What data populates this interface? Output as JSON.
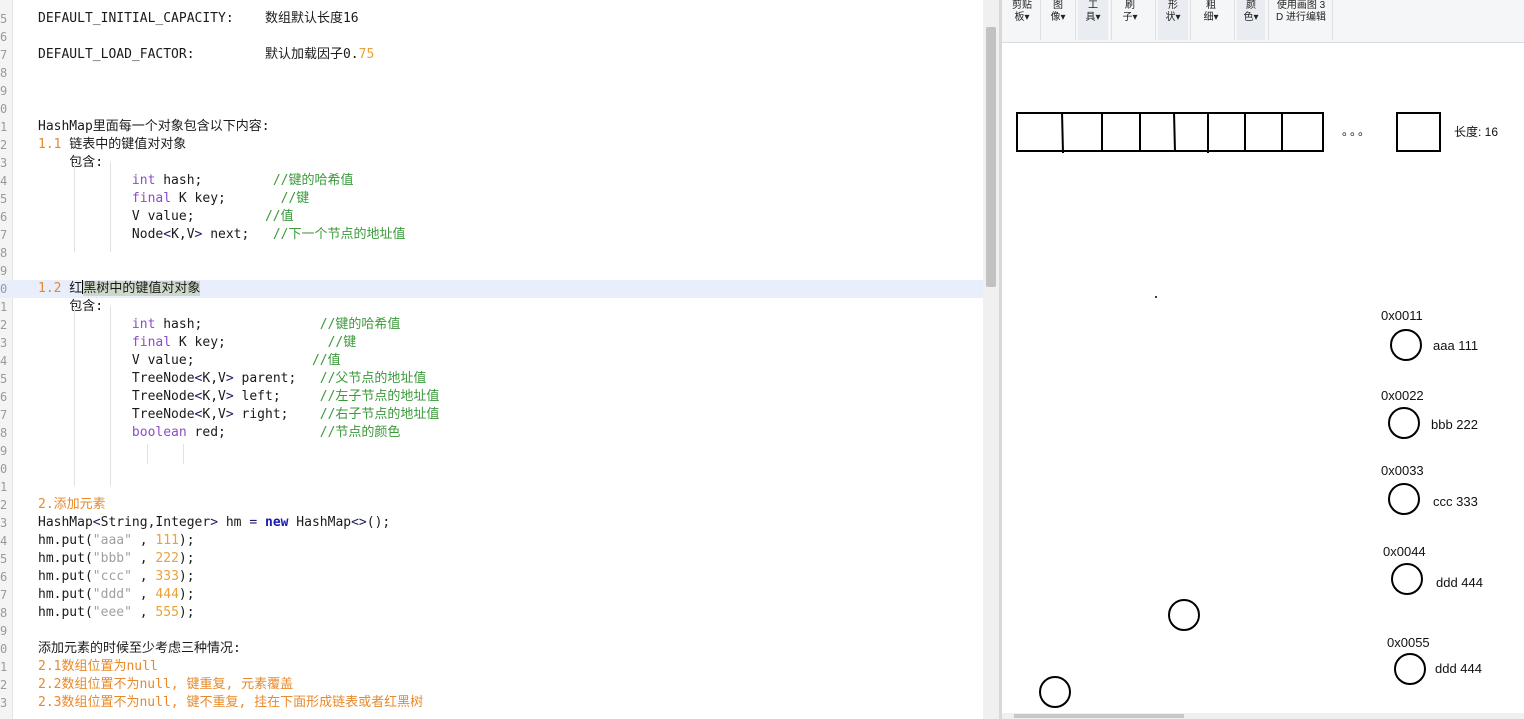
{
  "editor": {
    "lines": [
      {
        "n": "5",
        "segs": [
          [
            "DEFAULT_INITIAL_CAPACITY:    数组默认长度16",
            ""
          ]
        ]
      },
      {
        "n": "6",
        "segs": []
      },
      {
        "n": "7",
        "segs": [
          [
            "DEFAULT_LOAD_FACTOR:         默认加载因子0.",
            ""
          ],
          [
            "75",
            "num"
          ]
        ]
      },
      {
        "n": "8",
        "segs": []
      },
      {
        "n": "9",
        "segs": []
      },
      {
        "n": "0",
        "segs": []
      },
      {
        "n": "1",
        "segs": [
          [
            "HashMap里面每一个对象包含以下内容:",
            ""
          ]
        ]
      },
      {
        "n": "2",
        "segs": [
          [
            "1.1",
            "or"
          ],
          [
            " 链表中的键值对对象",
            ""
          ]
        ]
      },
      {
        "n": "3",
        "segs": [
          [
            "    包含:",
            ""
          ]
        ]
      },
      {
        "n": "4",
        "segs": [
          [
            "            ",
            ""
          ],
          [
            "int",
            "kw"
          ],
          [
            " hash;         ",
            ""
          ],
          [
            "//键的哈希值",
            "cm"
          ]
        ]
      },
      {
        "n": "5",
        "segs": [
          [
            "            ",
            ""
          ],
          [
            "final",
            "kw"
          ],
          [
            " K key;       ",
            ""
          ],
          [
            "//键",
            "cm"
          ]
        ]
      },
      {
        "n": "6",
        "segs": [
          [
            "            V value;         ",
            ""
          ],
          [
            "//值",
            "cm"
          ]
        ]
      },
      {
        "n": "7",
        "segs": [
          [
            "            Node",
            ""
          ],
          [
            "<",
            "op"
          ],
          [
            "K,V",
            ""
          ],
          [
            ">",
            "op"
          ],
          [
            " next;   ",
            ""
          ],
          [
            "//下一个节点的地址值",
            "cm"
          ]
        ]
      },
      {
        "n": "8",
        "segs": []
      },
      {
        "n": "9",
        "segs": []
      },
      {
        "n": "0",
        "segs": [
          [
            "1.2",
            "or"
          ],
          [
            " 红",
            ""
          ],
          [
            "黑树中的键值对对象",
            "sel"
          ]
        ],
        "highlight": true
      },
      {
        "n": "1",
        "segs": [
          [
            "    包含:",
            ""
          ]
        ]
      },
      {
        "n": "2",
        "segs": [
          [
            "            ",
            ""
          ],
          [
            "int",
            "kw"
          ],
          [
            " hash;               ",
            ""
          ],
          [
            "//键的哈希值",
            "cm"
          ]
        ]
      },
      {
        "n": "3",
        "segs": [
          [
            "            ",
            ""
          ],
          [
            "final",
            "kw"
          ],
          [
            " K key;             ",
            ""
          ],
          [
            "//键",
            "cm"
          ]
        ]
      },
      {
        "n": "4",
        "segs": [
          [
            "            V value;               ",
            ""
          ],
          [
            "//值",
            "cm"
          ]
        ]
      },
      {
        "n": "5",
        "segs": [
          [
            "            TreeNode",
            ""
          ],
          [
            "<",
            "op"
          ],
          [
            "K,V",
            ""
          ],
          [
            ">",
            "op"
          ],
          [
            " parent;   ",
            ""
          ],
          [
            "//父节点的地址值",
            "cm"
          ]
        ]
      },
      {
        "n": "6",
        "segs": [
          [
            "            TreeNode",
            ""
          ],
          [
            "<",
            "op"
          ],
          [
            "K,V",
            ""
          ],
          [
            ">",
            "op"
          ],
          [
            " left;     ",
            ""
          ],
          [
            "//左子节点的地址值",
            "cm"
          ]
        ]
      },
      {
        "n": "7",
        "segs": [
          [
            "            TreeNode",
            ""
          ],
          [
            "<",
            "op"
          ],
          [
            "K,V",
            ""
          ],
          [
            ">",
            "op"
          ],
          [
            " right;    ",
            ""
          ],
          [
            "//右子节点的地址值",
            "cm"
          ]
        ]
      },
      {
        "n": "8",
        "segs": [
          [
            "            ",
            ""
          ],
          [
            "boolean",
            "kw"
          ],
          [
            " red;            ",
            ""
          ],
          [
            "//节点的颜色",
            "cm"
          ]
        ]
      },
      {
        "n": "9",
        "segs": []
      },
      {
        "n": "0",
        "segs": []
      },
      {
        "n": "1",
        "segs": []
      },
      {
        "n": "2",
        "segs": [
          [
            "2.添加元素",
            "or"
          ]
        ]
      },
      {
        "n": "3",
        "segs": [
          [
            "HashMap",
            ""
          ],
          [
            "<",
            "op"
          ],
          [
            "String,Integer",
            ""
          ],
          [
            ">",
            "op"
          ],
          [
            " hm ",
            ""
          ],
          [
            "=",
            "op"
          ],
          [
            " ",
            ""
          ],
          [
            "new",
            "new"
          ],
          [
            " HashMap",
            ""
          ],
          [
            "<>",
            "op"
          ],
          [
            "();",
            ""
          ]
        ]
      },
      {
        "n": "4",
        "segs": [
          [
            "hm.put(",
            ""
          ],
          [
            "\"aaa\"",
            "str"
          ],
          [
            " , ",
            ""
          ],
          [
            "111",
            "num"
          ],
          [
            ");",
            ""
          ]
        ]
      },
      {
        "n": "5",
        "segs": [
          [
            "hm.put(",
            ""
          ],
          [
            "\"bbb\"",
            "str"
          ],
          [
            " , ",
            ""
          ],
          [
            "222",
            "num"
          ],
          [
            ");",
            ""
          ]
        ]
      },
      {
        "n": "6",
        "segs": [
          [
            "hm.put(",
            ""
          ],
          [
            "\"ccc\"",
            "str"
          ],
          [
            " , ",
            ""
          ],
          [
            "333",
            "num"
          ],
          [
            ");",
            ""
          ]
        ]
      },
      {
        "n": "7",
        "segs": [
          [
            "hm.put(",
            ""
          ],
          [
            "\"ddd\"",
            "str"
          ],
          [
            " , ",
            ""
          ],
          [
            "444",
            "num"
          ],
          [
            ");",
            ""
          ]
        ]
      },
      {
        "n": "8",
        "segs": [
          [
            "hm.put(",
            ""
          ],
          [
            "\"eee\"",
            "str"
          ],
          [
            " , ",
            ""
          ],
          [
            "555",
            "num"
          ],
          [
            ");",
            ""
          ]
        ]
      },
      {
        "n": "9",
        "segs": []
      },
      {
        "n": "0",
        "segs": [
          [
            "添加元素的时候至少考虑三种情况:",
            ""
          ]
        ]
      },
      {
        "n": "1",
        "segs": [
          [
            "2.1数组位置为null",
            "or"
          ]
        ]
      },
      {
        "n": "2",
        "segs": [
          [
            "2.2数组位置不为null, 键重复, 元素覆盖",
            "or"
          ]
        ]
      },
      {
        "n": "3",
        "segs": [
          [
            "2.3数组位置不为null, 键不重复, 挂在下面形成链表或者红黑树",
            "or"
          ]
        ]
      }
    ]
  },
  "paint": {
    "ribbon": [
      {
        "top": "剪贴",
        "bottom": "板"
      },
      {
        "top": "图",
        "bottom": "像"
      },
      {
        "top": "工",
        "bottom": "具"
      },
      {
        "top": "刷",
        "bottom": "子"
      },
      {
        "top": "形",
        "bottom": "状"
      },
      {
        "top": "粗",
        "bottom": "细"
      },
      {
        "top": "颜",
        "bottom": "色"
      },
      {
        "top": "使用画图 3",
        "bottom": "D 进行编辑"
      }
    ],
    "ellipsis": "。。。",
    "length_label": "长度: 16",
    "nodes": [
      {
        "addr": "0x0011",
        "entry": "aaa  111"
      },
      {
        "addr": "0x0022",
        "entry": "bbb 222"
      },
      {
        "addr": "0x0033",
        "entry": "ccc 333"
      },
      {
        "addr": "0x0044",
        "entry": "ddd 444"
      },
      {
        "addr": "0x0055",
        "entry": "ddd 444"
      }
    ]
  }
}
